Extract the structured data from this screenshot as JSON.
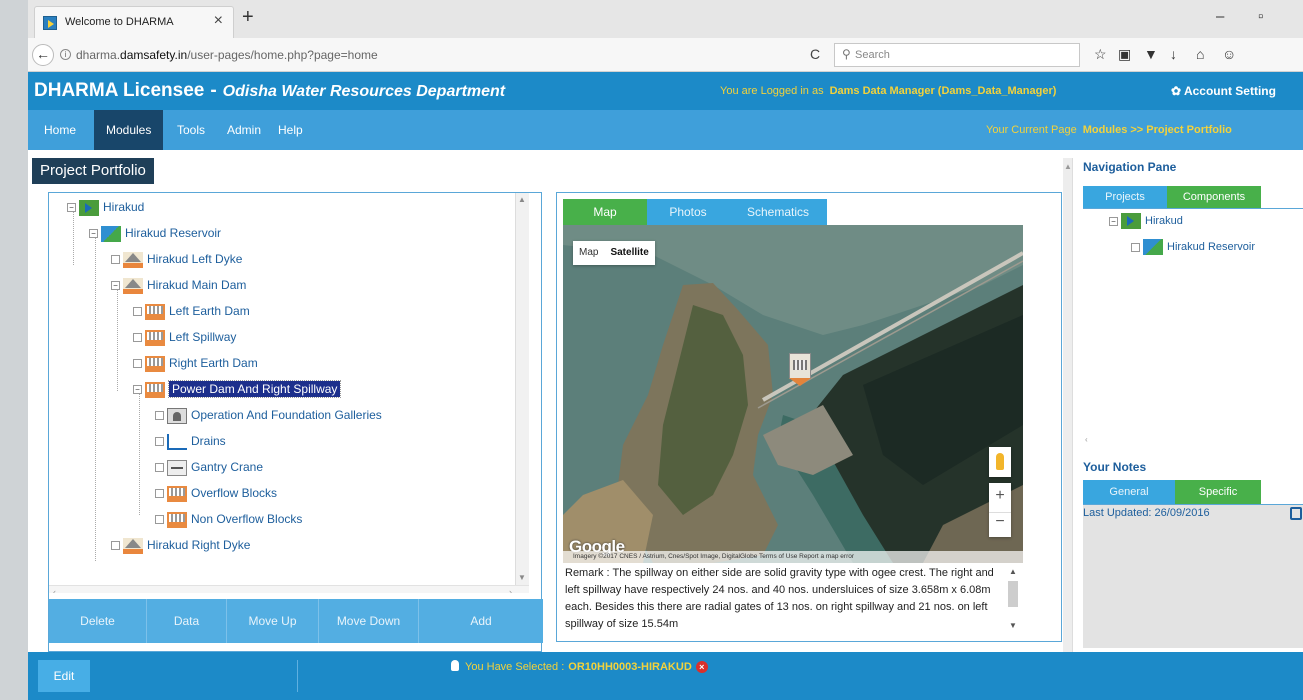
{
  "browser": {
    "tab_title": "Welcome to DHARMA",
    "url_prefix": "dharma.",
    "url_domain": "damsafety.in",
    "url_path": "/user-pages/home.php?page=home",
    "search_placeholder": "Search"
  },
  "header": {
    "app_name": "DHARMA Licensee",
    "separator": "-",
    "department": "Odisha Water Resources Department",
    "login_prefix": "You are Logged in as",
    "login_user": "Dams Data Manager (Dams_Data_Manager)",
    "account_settings": "Account Setting"
  },
  "menu": {
    "items": [
      "Home",
      "Modules",
      "Tools",
      "Admin",
      "Help"
    ],
    "active": "Modules",
    "current_page_label": "Your Current Page",
    "current_page_value": "Modules >> Project Portfolio"
  },
  "page_title": "Project Portfolio",
  "tree": [
    {
      "label": "Hirakud",
      "icon": "project-icon"
    },
    {
      "label": "Hirakud Reservoir",
      "icon": "reservoir-icon"
    },
    {
      "label": "Hirakud Left Dyke",
      "icon": "dam-icon"
    },
    {
      "label": "Hirakud Main Dam",
      "icon": "dam-icon"
    },
    {
      "label": "Left Earth Dam",
      "icon": "component-icon"
    },
    {
      "label": "Left Spillway",
      "icon": "component-icon"
    },
    {
      "label": "Right Earth Dam",
      "icon": "component-icon"
    },
    {
      "label": "Power Dam And Right Spillway",
      "icon": "component-icon",
      "selected": true
    },
    {
      "label": "Operation And Foundation Galleries",
      "icon": "gallery-icon"
    },
    {
      "label": "Drains",
      "icon": "drain-icon"
    },
    {
      "label": "Gantry Crane",
      "icon": "crane-icon"
    },
    {
      "label": "Overflow Blocks",
      "icon": "component-icon"
    },
    {
      "label": "Non Overflow Blocks",
      "icon": "component-icon"
    },
    {
      "label": "Hirakud Right Dyke",
      "icon": "dam-icon"
    }
  ],
  "tree_buttons": [
    "Delete",
    "Data",
    "Move Up",
    "Move Down",
    "Add"
  ],
  "media_tabs": [
    "Map",
    "Photos",
    "Schematics"
  ],
  "media_active_tab": "Map",
  "map": {
    "type_map": "Map",
    "type_satellite": "Satellite",
    "logo": "Google",
    "attribution": "Imagery ©2017 CNES / Astrium, Cnes/Spot Image, DigitalGlobe   Terms of Use   Report a map error",
    "zoom_in": "+",
    "zoom_out": "−"
  },
  "remark": "Remark : The spillway on either side are solid gravity type with ogee crest. The right and left spillway have respectively 24 nos. and 40 nos. undersluices of size 3.658m x 6.08m each. Besides this there are radial gates of 13 nos. on right spillway and 21 nos. on left spillway of size 15.54m",
  "nav_pane": {
    "title": "Navigation Pane",
    "tabs": [
      "Projects",
      "Components"
    ],
    "active_tab": "Components",
    "items": [
      "Hirakud",
      "Hirakud Reservoir"
    ]
  },
  "notes": {
    "title": "Your Notes",
    "tabs": [
      "General",
      "Specific"
    ],
    "active_tab": "Specific",
    "last_updated": "Last Updated: 26/09/2016"
  },
  "footer": {
    "edit": "Edit",
    "selected_label": "You Have Selected :",
    "selected_value": "OR10HH0003-HIRAKUD"
  },
  "colors": {
    "header_blue": "#1c8ac8",
    "menu_blue": "#3f9fda",
    "active_green": "#48b04a",
    "highlight_yellow": "#f3d23b",
    "selection_navy": "#1c2f8c"
  }
}
